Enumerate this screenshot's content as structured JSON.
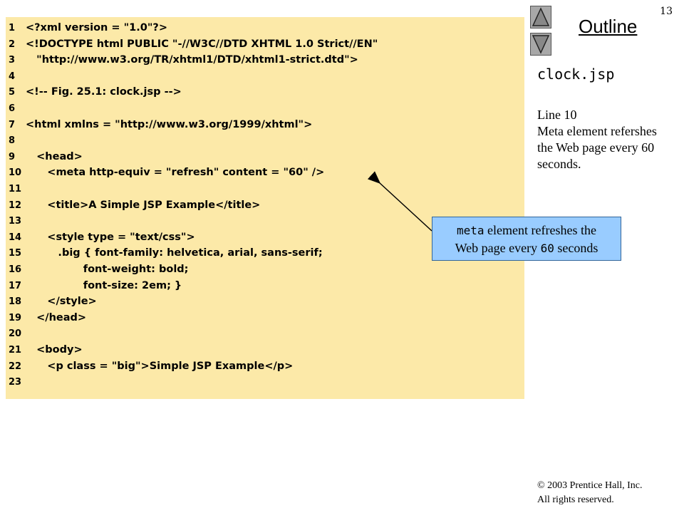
{
  "slide_number": "13",
  "outline": {
    "title": "Outline",
    "file": "clock.jsp",
    "note": "Line 10\nMeta element refershes the Web page every 60 seconds."
  },
  "code": [
    {
      "n": "1",
      "text": "<?xml version = \"1.0\"?>"
    },
    {
      "n": "2",
      "text": "<!DOCTYPE html PUBLIC \"-//W3C//DTD XHTML 1.0 Strict//EN\""
    },
    {
      "n": "3",
      "text": "   \"http://www.w3.org/TR/xhtml1/DTD/xhtml1-strict.dtd\">"
    },
    {
      "n": "4",
      "text": ""
    },
    {
      "n": "5",
      "text": "<!-- Fig. 25.1: clock.jsp -->"
    },
    {
      "n": "6",
      "text": ""
    },
    {
      "n": "7",
      "text": "<html xmlns = \"http://www.w3.org/1999/xhtml\">"
    },
    {
      "n": "8",
      "text": ""
    },
    {
      "n": "9",
      "text": "   <head>"
    },
    {
      "n": "10",
      "text": "      <meta http-equiv = \"refresh\" content = \"60\" />"
    },
    {
      "n": "11",
      "text": ""
    },
    {
      "n": "12",
      "text": "      <title>A Simple JSP Example</title>"
    },
    {
      "n": "13",
      "text": ""
    },
    {
      "n": "14",
      "text": "      <style type = \"text/css\">"
    },
    {
      "n": "15",
      "text": "         .big { font-family: helvetica, arial, sans-serif;"
    },
    {
      "n": "16",
      "text": "                font-weight: bold;"
    },
    {
      "n": "17",
      "text": "                font-size: 2em; }"
    },
    {
      "n": "18",
      "text": "      </style>"
    },
    {
      "n": "19",
      "text": "   </head>"
    },
    {
      "n": "20",
      "text": ""
    },
    {
      "n": "21",
      "text": "   <body>"
    },
    {
      "n": "22",
      "text": "      <p class = \"big\">Simple JSP Example</p>"
    },
    {
      "n": "23",
      "text": ""
    }
  ],
  "callout": {
    "code_word": "meta",
    "text_1": " element refreshes the",
    "text_2": "Web page every ",
    "code_num": "60",
    "text_3": " seconds"
  },
  "copyright": {
    "line1": "© 2003 Prentice Hall, Inc.",
    "line2": "All rights reserved."
  }
}
